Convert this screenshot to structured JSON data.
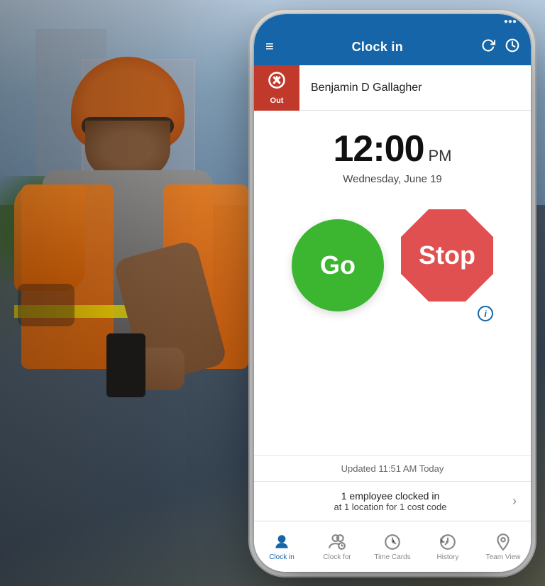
{
  "background": {
    "description": "Construction worker wearing orange safety vest and hard hat, looking at phone"
  },
  "phone": {
    "statusBar": {
      "visible": true
    },
    "navBar": {
      "title": "Clock in",
      "menuIcon": "≡",
      "icon1": "refresh",
      "icon2": "settings"
    },
    "userBar": {
      "iconLabel": "Out",
      "userName": "Benjamin D Gallagher"
    },
    "timeSection": {
      "time": "12:00",
      "ampm": "PM",
      "date": "Wednesday, June 19"
    },
    "buttons": {
      "go": "Go",
      "stop": "Stop"
    },
    "updatedText": "Updated 11:51 AM Today",
    "employeeSummary": {
      "line1": "1 employee clocked in",
      "line2": "at 1 location for 1 cost code"
    },
    "tabs": [
      {
        "id": "clock-in",
        "label": "Clock in",
        "active": true
      },
      {
        "id": "clock-for",
        "label": "Clock for",
        "active": false
      },
      {
        "id": "time-cards",
        "label": "Time Cards",
        "active": false
      },
      {
        "id": "history",
        "label": "History",
        "active": false
      },
      {
        "id": "team-view",
        "label": "Team View",
        "active": false
      }
    ]
  }
}
